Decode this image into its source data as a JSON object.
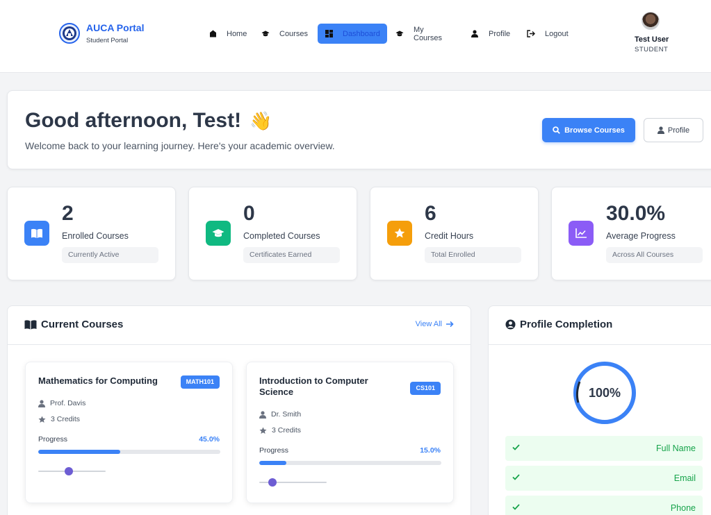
{
  "brand": {
    "title": "AUCA Portal",
    "subtitle": "Student Portal",
    "logo_text": "AUCA"
  },
  "nav": [
    {
      "label": "Home",
      "icon": "home-icon",
      "active": false
    },
    {
      "label": "Courses",
      "icon": "graduation-cap-icon",
      "active": false
    },
    {
      "label": "Dashboard",
      "icon": "dashboard-icon",
      "active": true
    },
    {
      "label": "My Courses",
      "icon": "graduation-cap-icon",
      "active": false
    },
    {
      "label": "Profile",
      "icon": "user-icon",
      "active": false
    },
    {
      "label": "Logout",
      "icon": "logout-icon",
      "active": false
    }
  ],
  "user": {
    "name": "Test User",
    "role": "STUDENT"
  },
  "welcome": {
    "greeting": "Good afternoon, Test!",
    "emoji": "👋",
    "subtitle": "Welcome back to your learning journey. Here's your academic overview.",
    "browse_label": "Browse Courses",
    "profile_label": "Profile"
  },
  "stats": [
    {
      "value": "2",
      "label": "Enrolled Courses",
      "chip": "Currently Active",
      "icon": "book-icon",
      "color": "#3b82f6"
    },
    {
      "value": "0",
      "label": "Completed Courses",
      "chip": "Certificates Earned",
      "icon": "graduation-cap-icon",
      "color": "#10b981"
    },
    {
      "value": "6",
      "label": "Credit Hours",
      "chip": "Total Enrolled",
      "icon": "star-icon",
      "color": "#f59e0b"
    },
    {
      "value": "30.0%",
      "label": "Average Progress",
      "chip": "Across All Courses",
      "icon": "chart-line-icon",
      "color": "#8b5cf6"
    }
  ],
  "current_courses": {
    "title": "Current Courses",
    "view_all": "View All",
    "items": [
      {
        "name": "Mathematics for Computing",
        "code": "MATH101",
        "instructor": "Prof. Davis",
        "credits": "3 Credits",
        "progress_label": "Progress",
        "progress_text": "45.0%",
        "progress": 0.45,
        "slider": 0.45
      },
      {
        "name": "Introduction to Computer Science",
        "code": "CS101",
        "instructor": "Dr. Smith",
        "credits": "3 Credits",
        "progress_label": "Progress",
        "progress_text": "15.0%",
        "progress": 0.15,
        "slider": 0.2
      }
    ]
  },
  "profile_completion": {
    "title": "Profile Completion",
    "percent_text": "100%",
    "percent": 1.0,
    "fields": [
      "Full Name",
      "Email",
      "Phone"
    ]
  },
  "colors": {
    "accent": "#3b82f6",
    "success": "#16a34a",
    "success_bg": "#ecfdf0",
    "ring": "#3b82f6"
  }
}
